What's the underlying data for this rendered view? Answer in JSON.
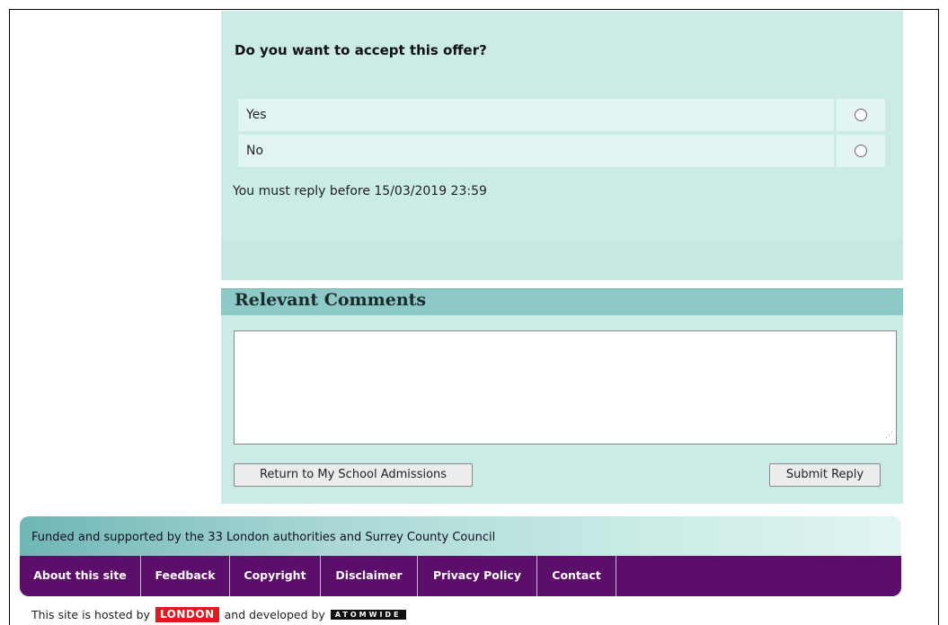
{
  "offer": {
    "question": "Do you want to accept this offer?",
    "options": [
      {
        "label": "Yes",
        "selected": false
      },
      {
        "label": "No",
        "selected": false
      }
    ],
    "deadline": "You must reply before 15/03/2019 23:59"
  },
  "comments": {
    "title": "Relevant Comments",
    "value": "",
    "return_button": "Return to My School Admissions",
    "submit_button": "Submit Reply"
  },
  "footer": {
    "funded_text": "Funded and supported by the 33 London authorities and Surrey County Council",
    "nav": [
      "About this site",
      "Feedback",
      "Copyright",
      "Disclaimer",
      "Privacy Policy",
      "Contact"
    ],
    "hosted_prefix": "This site is hosted by",
    "hosted_logo": "LONDON",
    "developed_prefix": "and developed by",
    "developed_logo": "ATOMWIDE"
  },
  "colors": {
    "panel": "#cbebe6",
    "header": "#8cc9c7",
    "nav": "#5b0f6b",
    "lgfl_red": "#d91c21"
  }
}
